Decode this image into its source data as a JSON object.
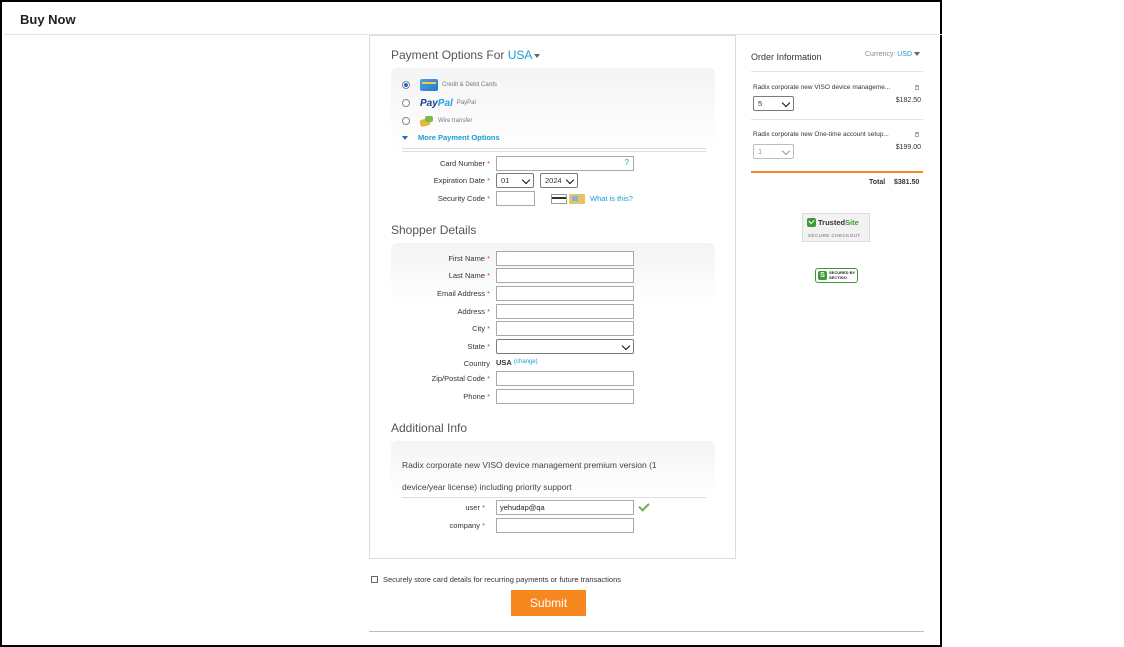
{
  "header": {
    "title": "Buy Now"
  },
  "payment": {
    "title_prefix": "Payment Options For",
    "country": "USA",
    "methods": [
      {
        "label": "Credit & Debit Cards",
        "icon": "credit-card-icon",
        "selected": true
      },
      {
        "label": "PayPal",
        "icon": "paypal-logo",
        "logo_text_a": "Pay",
        "logo_text_b": "Pal",
        "selected": false
      },
      {
        "label": "Wire transfer",
        "icon": "wire-transfer-icon",
        "selected": false
      }
    ],
    "more_label": "More Payment Options",
    "card_number_label": "Card Number",
    "card_help": "?",
    "expiration_label": "Expiration Date",
    "exp_month": "01",
    "exp_year": "2024",
    "security_label": "Security Code",
    "what_is_this": "What is this?"
  },
  "shopper": {
    "title": "Shopper Details",
    "first_name": "First Name",
    "last_name": "Last Name",
    "email": "Email Address",
    "address": "Address",
    "city": "City",
    "state": "State",
    "country_label": "Country",
    "country_value": "USA",
    "country_change": "(change)",
    "zip": "Zip/Postal Code",
    "phone": "Phone"
  },
  "additional": {
    "title": "Additional Info",
    "description": "Radix corporate new VISO device management premium version (1 device/year license) including priority support",
    "user_label": "user",
    "user_value": "yehudap@qa",
    "company_label": "company"
  },
  "required_mark": "*",
  "footer": {
    "store_label": "Securely store card details for recurring payments or future transactions",
    "submit_label": "Submit"
  },
  "order": {
    "title": "Order Information",
    "currency_label": "Currency:",
    "currency_value": "USD",
    "items": [
      {
        "name": "Radix corporate new VISO device manageme...",
        "qty": "5",
        "price": "$182.50",
        "qty_enabled": true
      },
      {
        "name": "Radix corporate new One-time account setup...",
        "qty": "1",
        "price": "$199.00",
        "qty_enabled": false
      }
    ],
    "total_label": "Total",
    "total_value": "$381.50"
  },
  "badges": {
    "trusted_name_a": "Trusted",
    "trusted_name_b": "Site",
    "trusted_sub": "SECURE CHECKOUT",
    "sectigo_top": "SECURED BY",
    "sectigo_name": "SECTIGO",
    "sectigo_mark": "S"
  },
  "colors": {
    "accent": "#1a9bd7",
    "submit": "#f7871f",
    "required": "#e53b2c",
    "valid": "#6ab04c"
  }
}
